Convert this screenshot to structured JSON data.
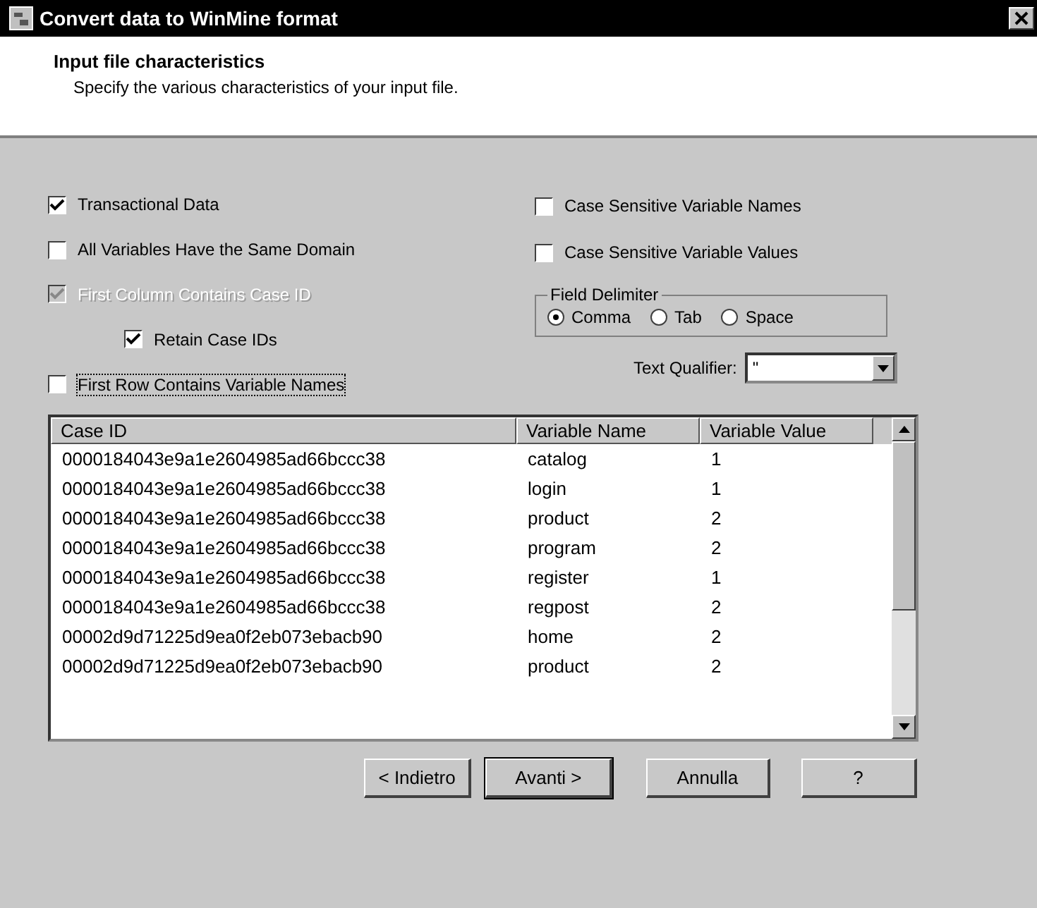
{
  "window": {
    "title": "Convert data to WinMine format"
  },
  "header": {
    "title": "Input file characteristics",
    "subtitle": "Specify the various characteristics of your input file."
  },
  "left_options": [
    {
      "label": "Transactional Data",
      "checked": true,
      "disabled": false,
      "indented": false
    },
    {
      "label": "All Variables Have the Same Domain",
      "checked": false,
      "disabled": false,
      "indented": false
    },
    {
      "label": "First Column Contains Case ID",
      "checked": true,
      "disabled": true,
      "indented": false
    },
    {
      "label": "Retain Case IDs",
      "checked": true,
      "disabled": false,
      "indented": true
    },
    {
      "label": "First Row Contains Variable Names",
      "checked": false,
      "disabled": false,
      "indented": false
    }
  ],
  "right_options": [
    {
      "label": "Case Sensitive Variable Names",
      "checked": false
    },
    {
      "label": "Case Sensitive Variable Values",
      "checked": false
    }
  ],
  "field_delimiter": {
    "title": "Field Delimiter",
    "options": [
      {
        "label": "Comma",
        "selected": true
      },
      {
        "label": "Tab",
        "selected": false
      },
      {
        "label": "Space",
        "selected": false
      }
    ]
  },
  "text_qualifier": {
    "label": "Text Qualifier:",
    "value": "\""
  },
  "table": {
    "columns": [
      "Case ID",
      "Variable Name",
      "Variable Value"
    ],
    "rows": [
      [
        "0000184043e9a1e2604985ad66bccc38",
        "catalog",
        "1"
      ],
      [
        "0000184043e9a1e2604985ad66bccc38",
        "login",
        "1"
      ],
      [
        "0000184043e9a1e2604985ad66bccc38",
        "product",
        "2"
      ],
      [
        "0000184043e9a1e2604985ad66bccc38",
        "program",
        "2"
      ],
      [
        "0000184043e9a1e2604985ad66bccc38",
        "register",
        "1"
      ],
      [
        "0000184043e9a1e2604985ad66bccc38",
        "regpost",
        "2"
      ],
      [
        "00002d9d71225d9ea0f2eb073ebacb90",
        "home",
        "2"
      ],
      [
        "00002d9d71225d9ea0f2eb073ebacb90",
        "product",
        "2"
      ]
    ]
  },
  "buttons": [
    {
      "label": "< Indietro",
      "default": false
    },
    {
      "label": "Avanti >",
      "default": true
    },
    {
      "label": "Annulla",
      "default": false
    },
    {
      "label": "?",
      "default": false
    }
  ]
}
